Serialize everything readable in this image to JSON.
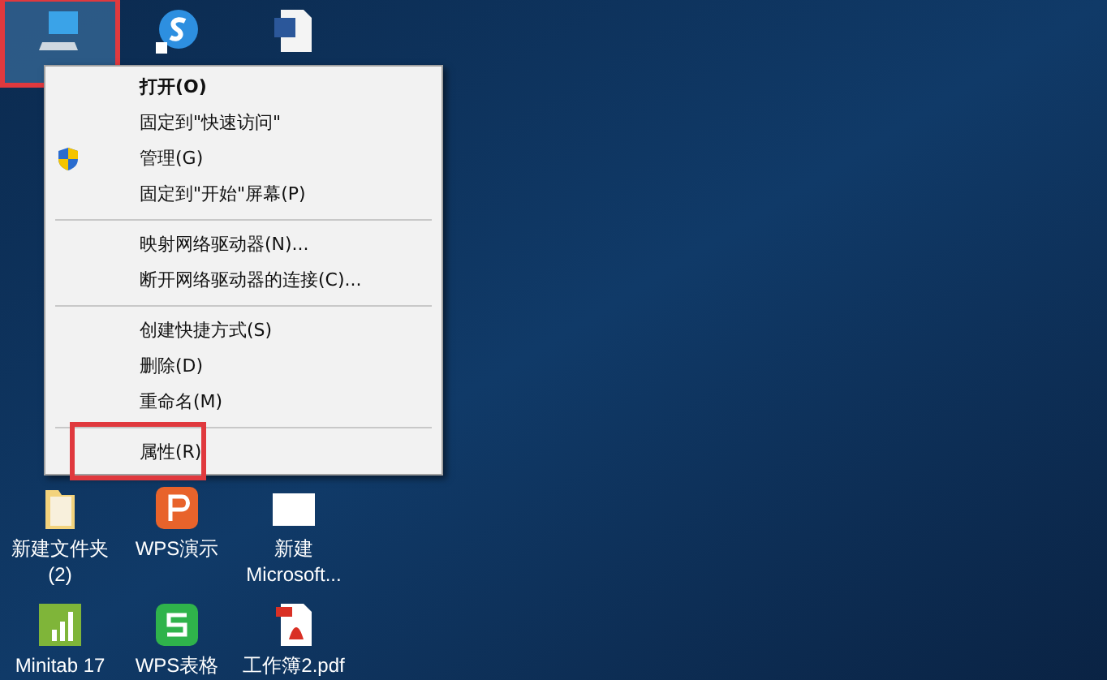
{
  "desktop_icons": [
    {
      "kind": "computer",
      "selected": true,
      "annotated": true
    },
    {
      "kind": "sogou",
      "selected": false,
      "annotated": false
    },
    {
      "kind": "word",
      "selected": false,
      "annotated": false
    },
    {
      "kind": "folder",
      "label": "新建文件夹\n(2)",
      "selected": false,
      "annotated": false
    },
    {
      "kind": "wps-presentation",
      "label": "WPS演示",
      "selected": false,
      "annotated": false
    },
    {
      "kind": "blank-doc",
      "label": "新建\nMicrosoft...",
      "selected": false,
      "annotated": false
    },
    {
      "kind": "minitab",
      "label": "Minitab 17",
      "selected": false,
      "annotated": false
    },
    {
      "kind": "wps-sheet",
      "label": "WPS表格",
      "selected": false,
      "annotated": false
    },
    {
      "kind": "pdf",
      "label": "工作簿2.pdf",
      "selected": false,
      "annotated": false
    }
  ],
  "context_menu": {
    "groups": [
      [
        {
          "label": "打开(O)",
          "kind": "plain",
          "bold": true,
          "annotated": false
        },
        {
          "label": "固定到\"快速访问\"",
          "kind": "plain",
          "bold": false,
          "annotated": false
        },
        {
          "label": "管理(G)",
          "kind": "shield",
          "bold": false,
          "annotated": false
        },
        {
          "label": "固定到\"开始\"屏幕(P)",
          "kind": "plain",
          "bold": false,
          "annotated": false
        }
      ],
      [
        {
          "label": "映射网络驱动器(N)...",
          "kind": "plain",
          "bold": false,
          "annotated": false
        },
        {
          "label": "断开网络驱动器的连接(C)...",
          "kind": "plain",
          "bold": false,
          "annotated": false
        }
      ],
      [
        {
          "label": "创建快捷方式(S)",
          "kind": "plain",
          "bold": false,
          "annotated": false
        },
        {
          "label": "删除(D)",
          "kind": "plain",
          "bold": false,
          "annotated": false
        },
        {
          "label": "重命名(M)",
          "kind": "plain",
          "bold": false,
          "annotated": false
        }
      ],
      [
        {
          "label": "属性(R)",
          "kind": "plain",
          "bold": false,
          "annotated": true
        }
      ]
    ]
  }
}
